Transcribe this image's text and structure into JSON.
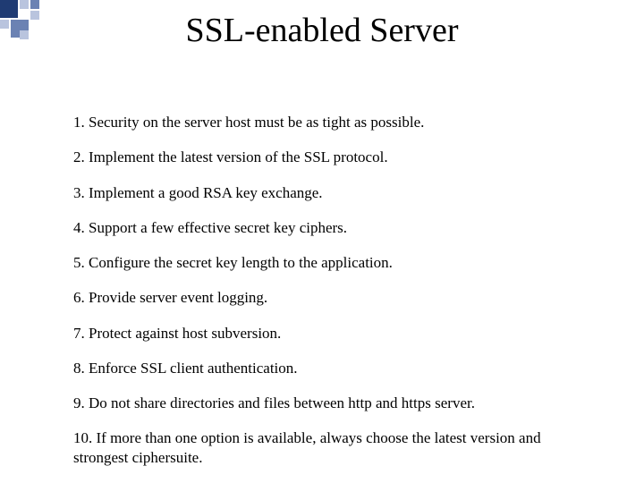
{
  "title": "SSL-enabled Server",
  "items": [
    "1. Security on the  server host must be as tight as possible.",
    "2. Implement the latest version of the SSL protocol.",
    "3. Implement a good RSA key exchange.",
    "4. Support a few effective secret key ciphers.",
    "5. Configure the secret key length to the application.",
    "6. Provide server event logging.",
    "7. Protect against host subversion.",
    "8. Enforce SSL client authentication.",
    "9. Do not share directories and files  between http and https server.",
    "10. If more than one option is available, always choose the latest version and strongest ciphersuite."
  ],
  "decor_colors": {
    "dark": "#1f3b73",
    "mid": "#6b82b3",
    "light": "#b9c4de"
  }
}
